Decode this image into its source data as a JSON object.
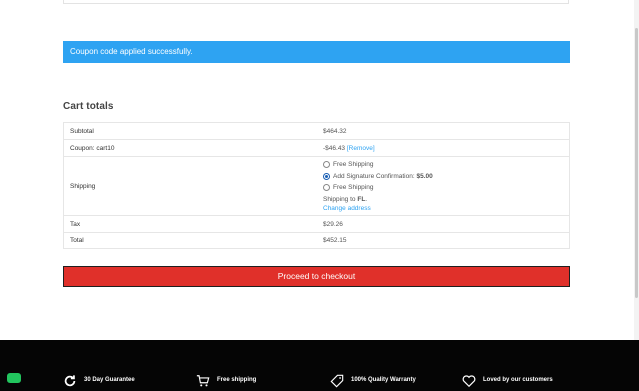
{
  "notice": {
    "text": "Coupon code applied successfully."
  },
  "cart_totals": {
    "title": "Cart totals",
    "subtotal": {
      "label": "Subtotal",
      "value": "$464.32"
    },
    "coupon": {
      "label": "Coupon: cart10",
      "value": "-$46.43",
      "remove": "[Remove]"
    },
    "shipping": {
      "label": "Shipping",
      "options": [
        {
          "label": "Free Shipping",
          "price": "",
          "checked": false
        },
        {
          "label": "Add Signature Confirmation:",
          "price": "$5.00",
          "checked": true
        },
        {
          "label": "Free Shipping",
          "price": "",
          "checked": false
        }
      ],
      "ship_to_prefix": "Shipping to",
      "ship_to_state": "FL",
      "change_address": "Change address"
    },
    "tax": {
      "label": "Tax",
      "value": "$29.26"
    },
    "total": {
      "label": "Total",
      "value": "$452.15"
    }
  },
  "checkout": {
    "label": "Proceed to checkout",
    "color": "#e0302a"
  },
  "footer": {
    "features": [
      {
        "icon": "refresh-icon",
        "title": "30 Day Guarantee"
      },
      {
        "icon": "cart-icon",
        "title": "Free shipping"
      },
      {
        "icon": "tag-icon",
        "title": "100% Quality Warranty"
      },
      {
        "icon": "heart-icon",
        "title": "Loved by our customers"
      }
    ]
  },
  "colors": {
    "accent": "#2ea3f2",
    "footer_bg": "#050505",
    "chat": "#22c55e"
  }
}
